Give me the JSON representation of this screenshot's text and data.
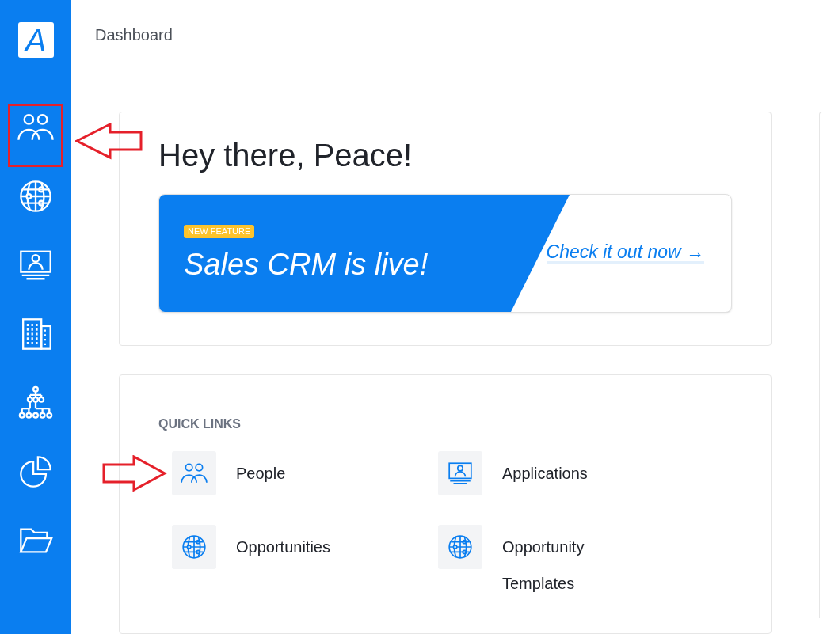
{
  "logo": {
    "letter": "A"
  },
  "sidebar": {
    "items": [
      {
        "kind": "people",
        "highlighted": true
      },
      {
        "kind": "globe",
        "highlighted": false
      },
      {
        "kind": "monitor",
        "highlighted": false
      },
      {
        "kind": "building",
        "highlighted": false
      },
      {
        "kind": "hierarchy",
        "highlighted": false
      },
      {
        "kind": "pie",
        "highlighted": false
      },
      {
        "kind": "folder",
        "highlighted": false
      }
    ]
  },
  "header": {
    "title": "Dashboard"
  },
  "greeting": "Hey there, Peace!",
  "banner": {
    "badge": "NEW FEATURE",
    "headline": "Sales CRM is live!",
    "link": "Check it out now →"
  },
  "quick_links": {
    "title": "QUICK LINKS",
    "items": [
      {
        "kind": "people",
        "label": "People",
        "pointed": true
      },
      {
        "kind": "monitor",
        "label": "Applications",
        "pointed": false
      },
      {
        "kind": "globe",
        "label": "Opportunities",
        "pointed": false
      },
      {
        "kind": "globe",
        "label": "Opportunity Templates",
        "pointed": false
      }
    ]
  }
}
